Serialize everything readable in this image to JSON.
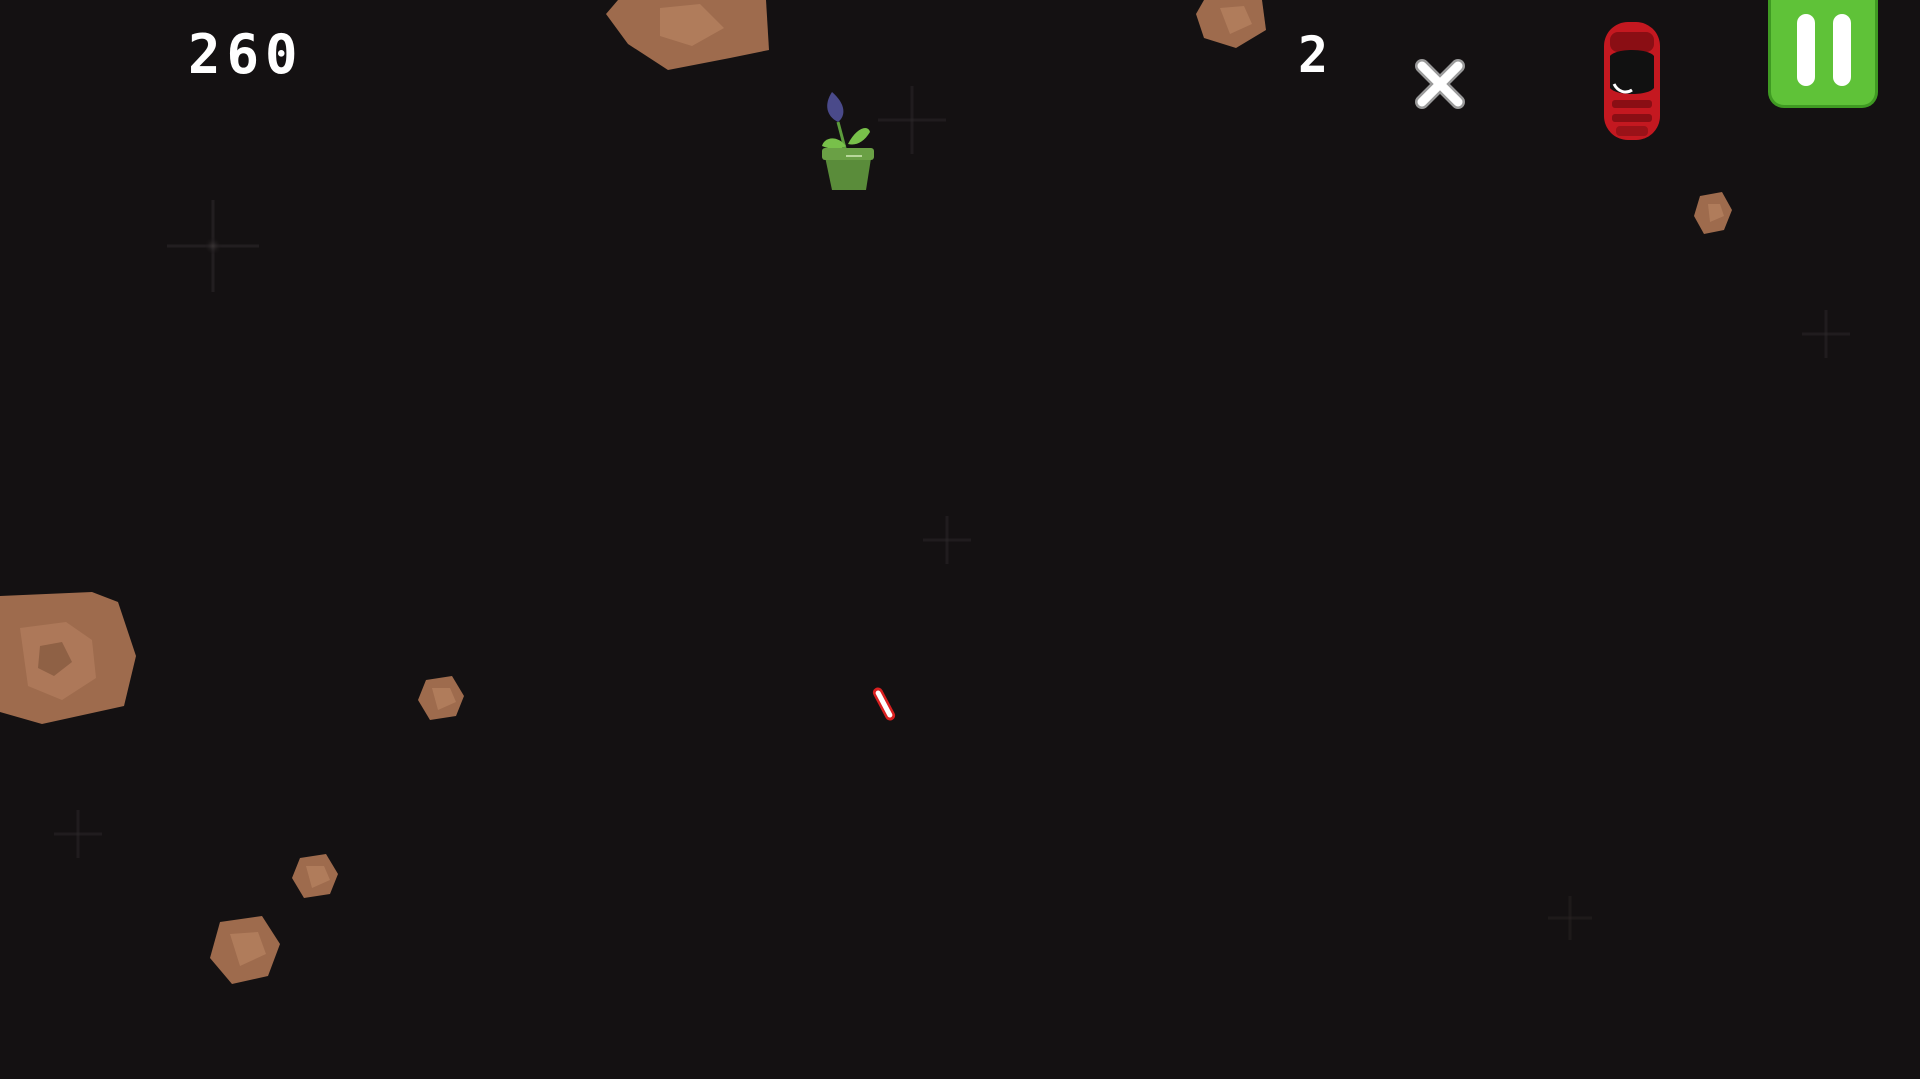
{
  "hud": {
    "score": "260",
    "lives": "2",
    "multiplier_icon": "close-x-icon",
    "player_icon": "red-car-ship-icon",
    "pause_icon": "pause-icon"
  },
  "world": {
    "background_color": "#141112",
    "asteroid_color": "#9e6b4d",
    "asteroid_shade": "#bf8a68",
    "asteroid_dark": "#7c5139",
    "objects": [
      "large-asteroid-top",
      "small-asteroid-top-right",
      "tiny-asteroid-right",
      "large-asteroid-left",
      "small-asteroid-mid-left",
      "small-asteroid-low-left",
      "small-asteroid-bottom-left",
      "potted-flower",
      "player-bullet"
    ]
  },
  "colors": {
    "pause_button": "#5fc238",
    "hud_text": "#ffffff",
    "ship_red": "#c41820",
    "bullet": "#d92020"
  }
}
